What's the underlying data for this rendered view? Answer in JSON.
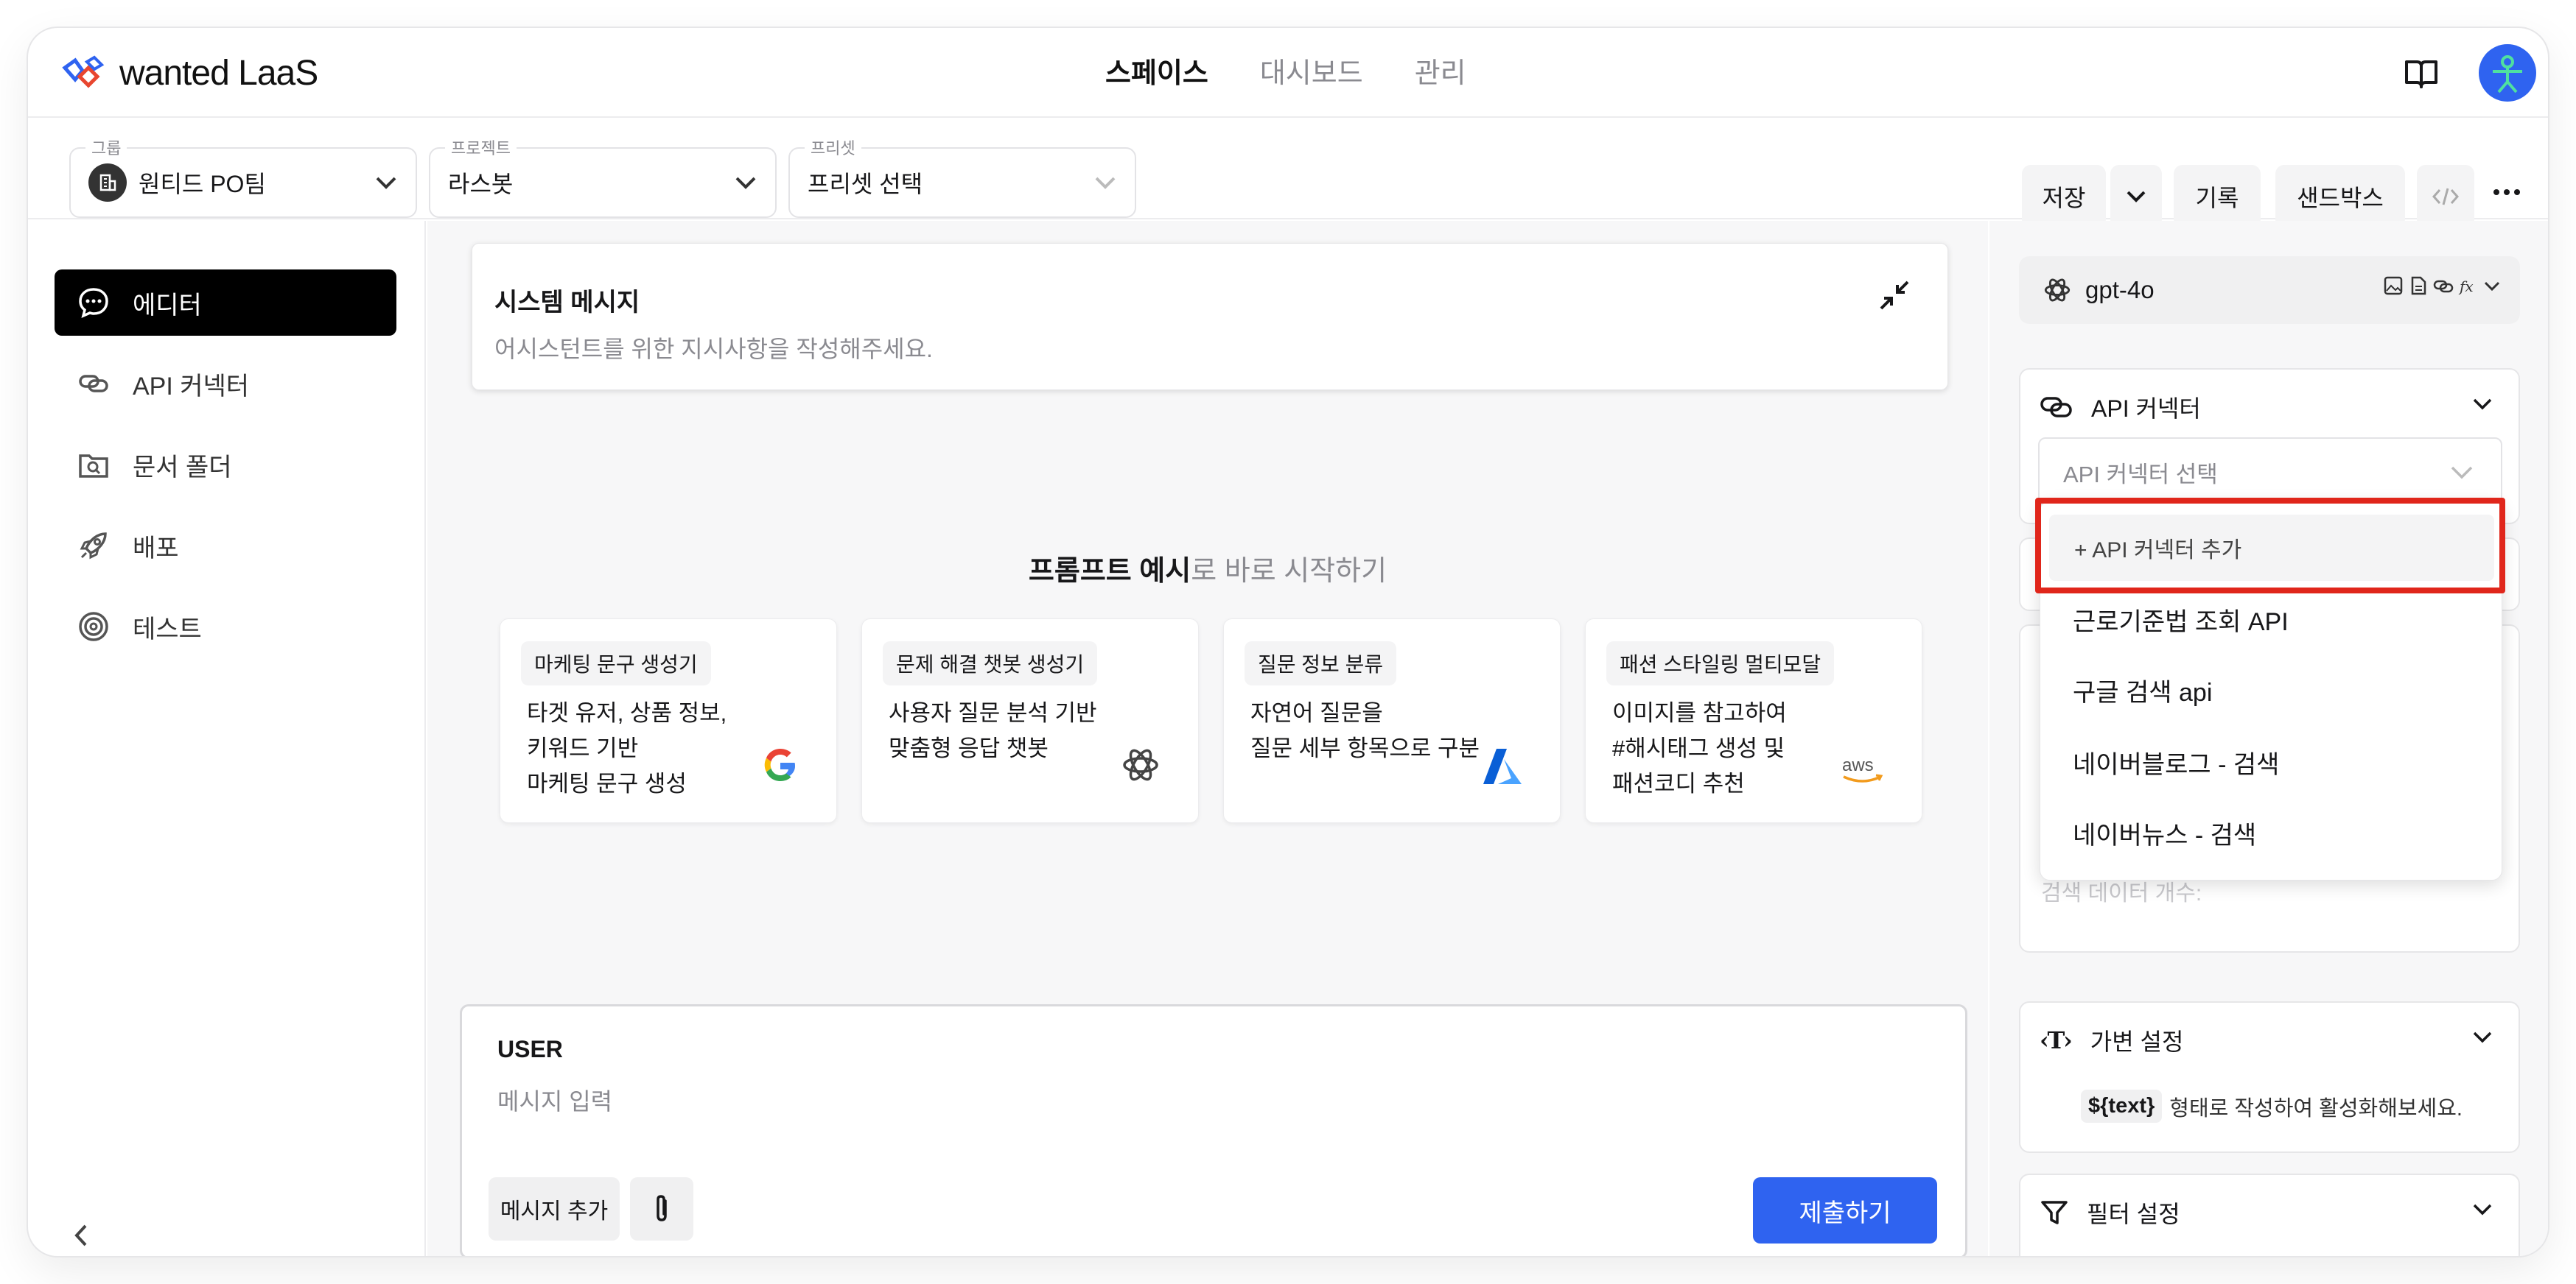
{
  "app": {
    "logo_text": "wanted LaaS",
    "nav_tabs": [
      {
        "label": "스페이스",
        "active": true
      },
      {
        "label": "대시보드",
        "active": false
      },
      {
        "label": "관리",
        "active": false
      }
    ]
  },
  "toolbar": {
    "group": {
      "label": "그룹",
      "value": "원티드 PO팀"
    },
    "project": {
      "label": "프로젝트",
      "value": "라스봇"
    },
    "preset": {
      "label": "프리셋",
      "value": "프리셋 선택"
    },
    "save_label": "저장",
    "history_label": "기록",
    "sandbox_label": "샌드박스"
  },
  "sidebar": {
    "items": [
      {
        "label": "에디터",
        "icon": "chat-bubble-icon",
        "active": true
      },
      {
        "label": "API 커넥터",
        "icon": "link-icon",
        "active": false
      },
      {
        "label": "문서 폴더",
        "icon": "folder-search-icon",
        "active": false
      },
      {
        "label": "배포",
        "icon": "rocket-icon",
        "active": false
      },
      {
        "label": "테스트",
        "icon": "target-icon",
        "active": false
      }
    ]
  },
  "main": {
    "system": {
      "title": "시스템 메시지",
      "placeholder": "어시스턴트를 위한 지시사항을 작성해주세요."
    },
    "examples_heading_bold": "프롬프트 예시",
    "examples_heading_rest": "로 바로 시작하기",
    "examples": [
      {
        "tag": "마케팅 문구 생성기",
        "desc": "타겟 유저, 상품 정보,\n키워드 기반\n마케팅 문구 생성",
        "logo": "google-icon"
      },
      {
        "tag": "문제 해결 챗봇 생성기",
        "desc": "사용자 질문 분석 기반\n맞춤형 응답 챗봇",
        "logo": "openai-icon"
      },
      {
        "tag": "질문 정보 분류",
        "desc": "자연어 질문을\n질문 세부 항목으로 구분",
        "logo": "azure-icon"
      },
      {
        "tag": "패션 스타일링 멀티모달",
        "desc": "이미지를 참고하여\n#해시태그 생성 및\n패션코디 추천",
        "logo": "aws-icon"
      }
    ],
    "user": {
      "title": "USER",
      "placeholder": "메시지 입력",
      "add_message_label": "메시지 추가",
      "submit_label": "제출하기"
    }
  },
  "rpanel": {
    "model": "gpt-4o",
    "api_connector": {
      "title": "API 커넥터",
      "select_placeholder": "API 커넥터 선택"
    },
    "dropdown": {
      "add_label": "+ API 커넥터 추가",
      "items": [
        "근로기준법 조회 API",
        "구글 검색 api",
        "네이버블로그 - 검색",
        "네이버뉴스 - 검색"
      ]
    },
    "hidden_field": "검색 데이터 개수:",
    "variable": {
      "title": "가변 설정",
      "code": "${text}",
      "hint": "형태로 작성하여 활성화해보세요."
    },
    "filter": {
      "title": "필터 설정"
    }
  },
  "colors": {
    "accent": "#2f63f0",
    "highlight": "#e0261b",
    "active_nav": "#000000"
  }
}
